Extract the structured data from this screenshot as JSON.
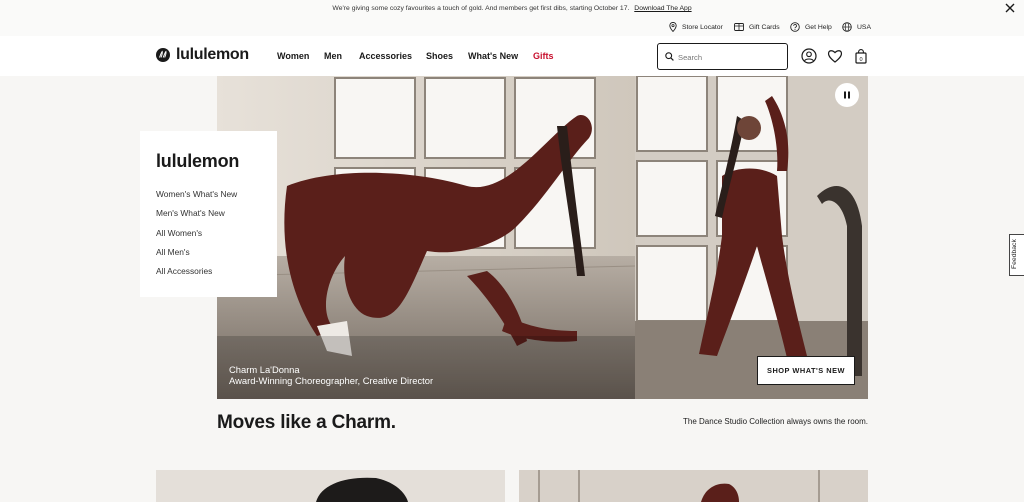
{
  "promo": {
    "text": "We're giving some cozy favourites a touch of gold. And members get first dibs, starting October 17.",
    "link": "Download The App"
  },
  "utility": {
    "store_locator": "Store Locator",
    "gift_cards": "Gift Cards",
    "get_help": "Get Help",
    "region": "USA"
  },
  "header": {
    "brand": "lululemon",
    "nav": [
      "Women",
      "Men",
      "Accessories",
      "Shoes",
      "What's New",
      "Gifts"
    ],
    "search_placeholder": "Search"
  },
  "side_menu": {
    "title": "lululemon",
    "links": [
      "Women's What's New",
      "Men's What's New",
      "All Women's",
      "All Men's",
      "All Accessories"
    ]
  },
  "hero": {
    "caption_name": "Charm La'Donna",
    "caption_role": "Award-Winning Choreographer, Creative Director",
    "cta": "SHOP WHAT'S NEW"
  },
  "section": {
    "headline": "Moves like a Charm.",
    "tagline": "The Dance Studio Collection always owns the room."
  },
  "feedback": "Feedback",
  "colors": {
    "accent_red": "#c8102e",
    "outfit": "#5a1f1a"
  },
  "icons": [
    "close-icon",
    "location-pin-icon",
    "gift-card-icon",
    "help-icon",
    "globe-icon",
    "search-icon",
    "account-icon",
    "heart-icon",
    "bag-icon",
    "pause-icon"
  ]
}
